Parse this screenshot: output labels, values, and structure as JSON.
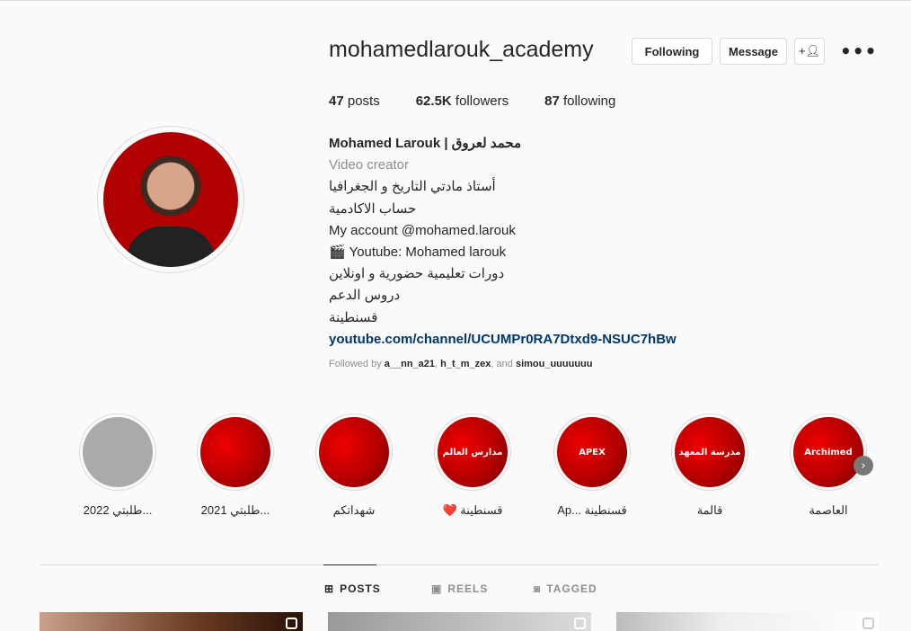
{
  "profile": {
    "username": "mohamedlarouk_academy",
    "buttons": {
      "following": "Following",
      "message": "Message",
      "suggest_icon": "add-user-icon",
      "more_icon": "more-icon"
    },
    "stats": {
      "posts_count": "47",
      "posts_label": "posts",
      "followers_count": "62.5K",
      "followers_label": "followers",
      "following_count": "87",
      "following_label": "following"
    },
    "bio": {
      "name": "Mohamed Larouk | محمد لعروق",
      "category": "Video creator",
      "lines": [
        "أستاذ مادتي التاريخ و الجغرافيا",
        "حساب الاكادمية",
        "My account @mohamed.larouk",
        "🎬 Youtube: Mohamed larouk",
        "دورات تعليمية حضورية و اونلاين",
        "دروس الدعم",
        "قسنطينة"
      ],
      "link": "youtube.com/channel/UCUMPr0RA7Dtxd9-NSUC7hBw"
    },
    "followed_by": {
      "prefix": "Followed by",
      "users": [
        "a__nn_a21",
        "h_t_m_zex",
        "simou_uuuuuuu"
      ],
      "sep": ", ",
      "and": ", and"
    }
  },
  "highlights": [
    {
      "label": "طلبتي 2022...",
      "cover": ""
    },
    {
      "label": "طلبتي 2021...",
      "cover": ""
    },
    {
      "label": "شهداتكم",
      "cover": ""
    },
    {
      "label": "❤️ قسنطينة",
      "cover": "مدارس العالم"
    },
    {
      "label": "Ap... قسنطينة",
      "cover": "APEX"
    },
    {
      "label": "قالمة",
      "cover": "مدرسة المعهد"
    },
    {
      "label": "العاصمة",
      "cover": "Archimed"
    }
  ],
  "tabs": [
    {
      "label": "POSTS",
      "icon": "grid-icon",
      "active": true
    },
    {
      "label": "REELS",
      "icon": "reels-icon"
    },
    {
      "label": "TAGGED",
      "icon": "tagged-icon"
    }
  ]
}
